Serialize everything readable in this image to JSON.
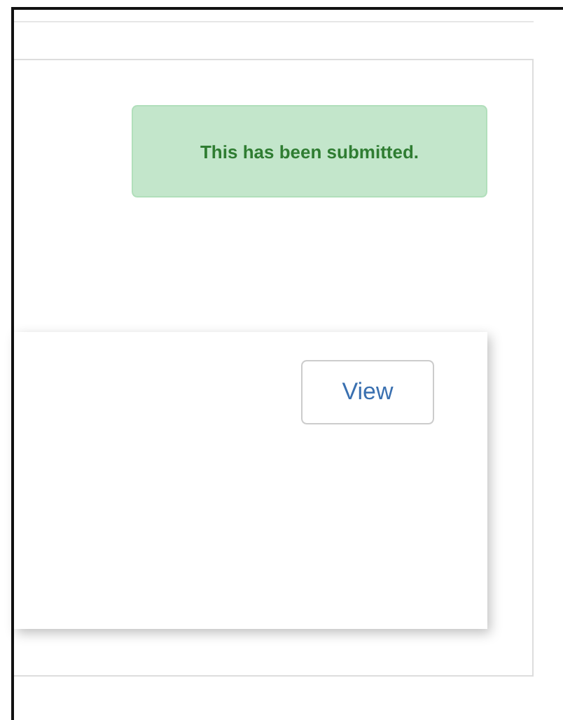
{
  "alert": {
    "message": "This has been submitted."
  },
  "card": {
    "button": "View"
  }
}
